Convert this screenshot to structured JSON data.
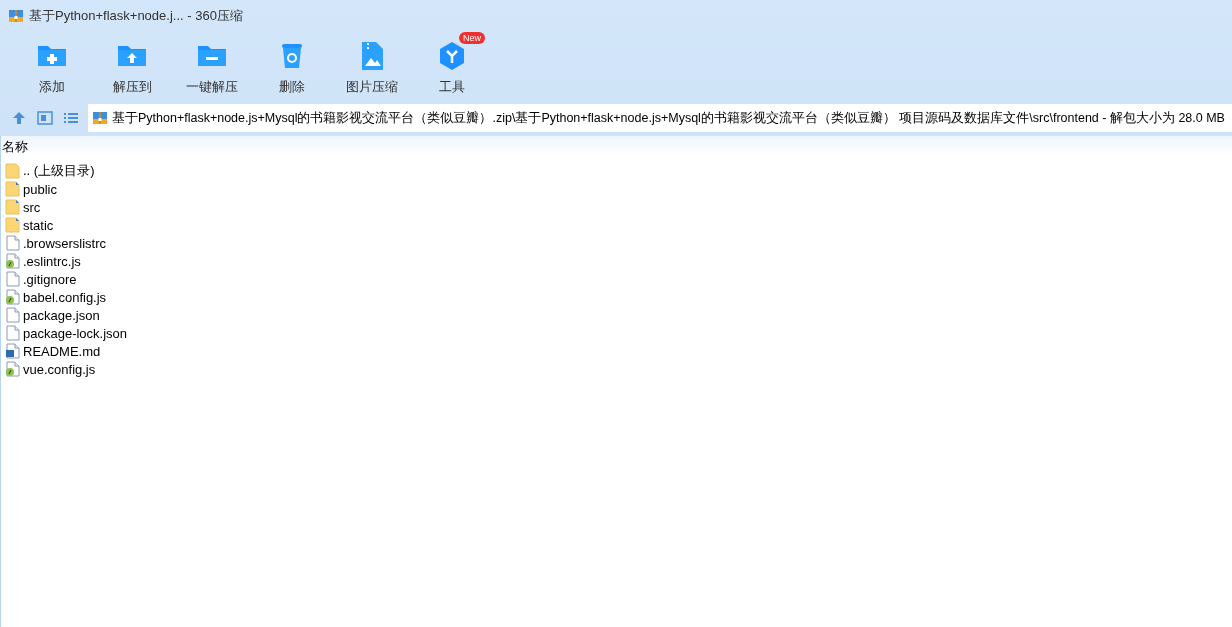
{
  "window": {
    "title": "基于Python+flask+node.j... - 360压缩"
  },
  "toolbar": [
    {
      "label": "添加",
      "kind": "add"
    },
    {
      "label": "解压到",
      "kind": "extract"
    },
    {
      "label": "一键解压",
      "kind": "oneclick"
    },
    {
      "label": "删除",
      "kind": "delete"
    },
    {
      "label": "图片压缩",
      "kind": "image"
    },
    {
      "label": "工具",
      "kind": "tools",
      "badge": "New"
    }
  ],
  "address": {
    "path": "基于Python+flask+node.js+Mysql的书籍影视交流平台（类似豆瓣）.zip\\基于Python+flask+node.js+Mysql的书籍影视交流平台（类似豆瓣） 项目源码及数据库文件\\src\\frontend - 解包大小为 28.0 MB"
  },
  "table": {
    "columns": [
      "名称"
    ],
    "rows": [
      {
        "name": ".. (上级目录)",
        "kind": "parent"
      },
      {
        "name": "public",
        "kind": "folder"
      },
      {
        "name": "src",
        "kind": "folder"
      },
      {
        "name": "static",
        "kind": "folder"
      },
      {
        "name": ".browserslistrc",
        "kind": "file"
      },
      {
        "name": ".eslintrc.js",
        "kind": "script"
      },
      {
        "name": ".gitignore",
        "kind": "file"
      },
      {
        "name": "babel.config.js",
        "kind": "script"
      },
      {
        "name": "package.json",
        "kind": "file"
      },
      {
        "name": "package-lock.json",
        "kind": "file"
      },
      {
        "name": "README.md",
        "kind": "doc"
      },
      {
        "name": "vue.config.js",
        "kind": "script"
      }
    ]
  }
}
